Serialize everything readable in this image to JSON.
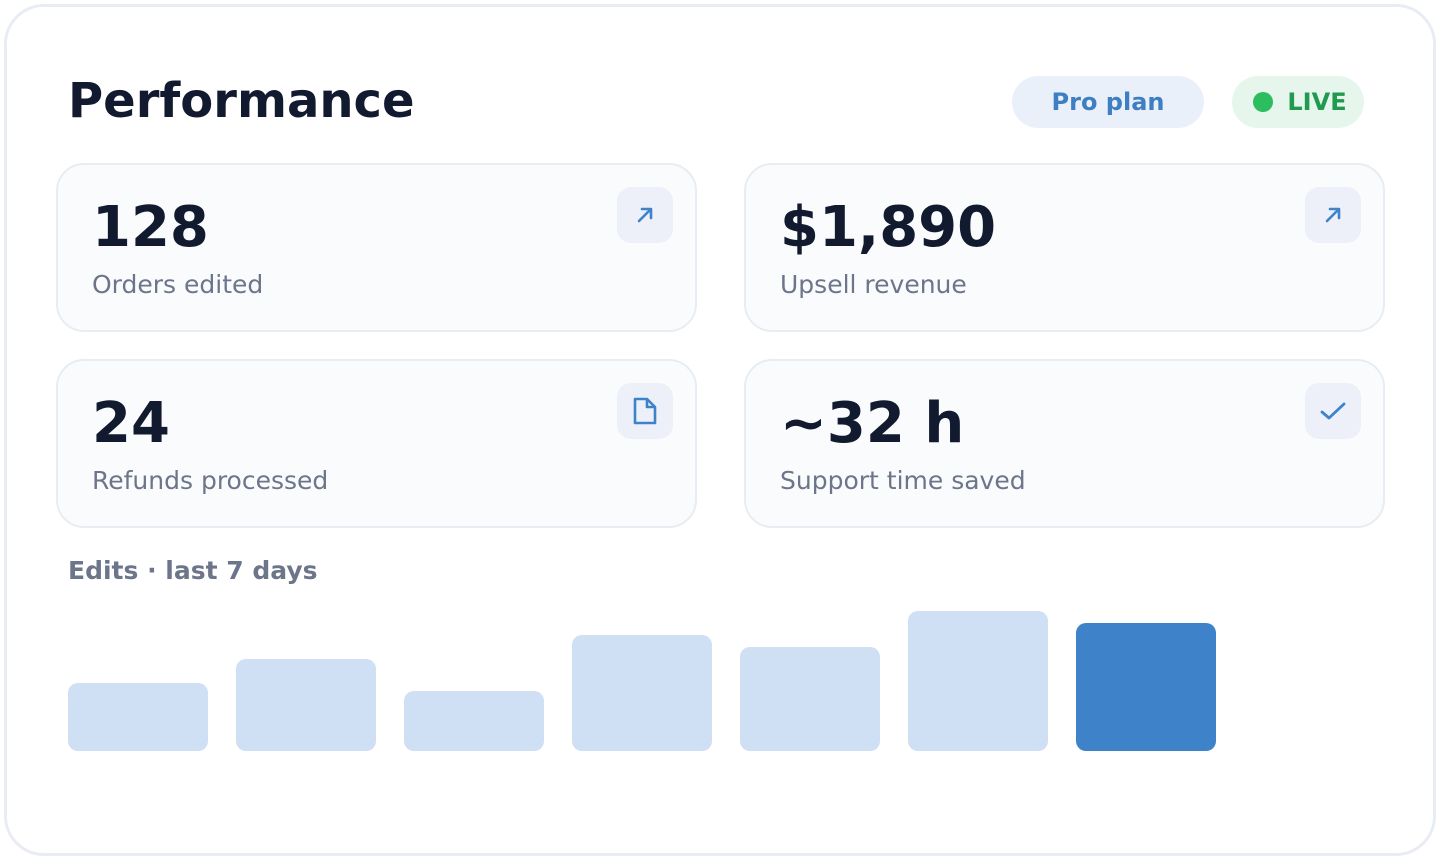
{
  "header": {
    "title": "Performance",
    "plan_label": "Pro plan",
    "live_label": "LIVE"
  },
  "cards": [
    {
      "value": "128",
      "label": "Orders edited",
      "icon": "arrow-up-right-icon"
    },
    {
      "value": "$1,890",
      "label": "Upsell revenue",
      "icon": "arrow-up-right-icon"
    },
    {
      "value": "24",
      "label": "Refunds processed",
      "icon": "document-icon"
    },
    {
      "value": "~32 h",
      "label": "Support time saved",
      "icon": "checkmark-icon"
    }
  ],
  "colors": {
    "accent": "#3e83c9",
    "bar_muted": "#cfdff4",
    "live_green": "#2cbd5e",
    "text_dark": "#111a2e",
    "text_muted": "#6c7589"
  },
  "chart_title": "Edits · last 7 days",
  "chart_data": {
    "type": "bar",
    "title": "Edits · last 7 days",
    "categories": [
      "",
      "",
      "",
      "",
      "",
      "",
      ""
    ],
    "values": [
      17,
      23,
      15,
      29,
      26,
      35,
      32
    ],
    "ylim": [
      0,
      35
    ],
    "highlight_index": 6,
    "grid": false,
    "legend": "none"
  }
}
